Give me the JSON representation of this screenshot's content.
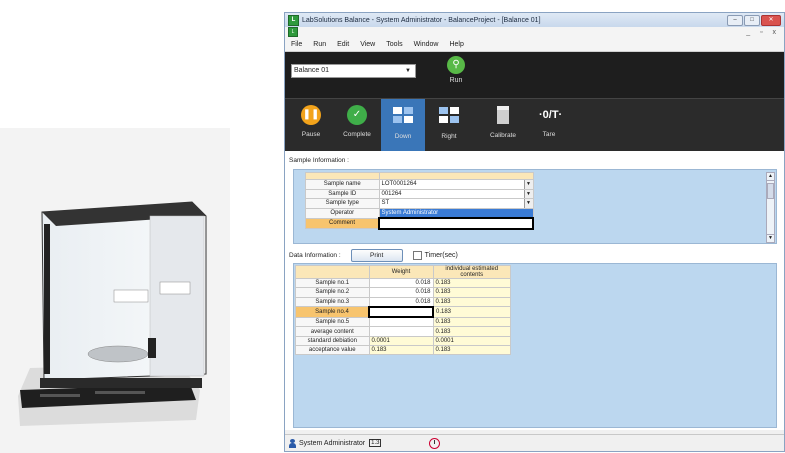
{
  "window": {
    "title": "LabSolutions Balance - System Administrator - BalanceProject - [Balance 01]",
    "buttons": [
      "–",
      "□",
      "✕"
    ],
    "mdi_buttons": "_ ▫ x"
  },
  "menu": [
    "File",
    "Run",
    "Edit",
    "View",
    "Tools",
    "Window",
    "Help"
  ],
  "run_panel": {
    "balance_selected": "Balance 01",
    "run_label": "Run"
  },
  "toolbar": {
    "buttons": [
      {
        "label": "Pause",
        "icon": "pause-icon"
      },
      {
        "label": "Complete",
        "icon": "check-icon"
      },
      {
        "label": "Down",
        "icon": "grid-down-icon",
        "active": true
      },
      {
        "label": "Right",
        "icon": "grid-right-icon"
      },
      {
        "label": "Calibrate",
        "icon": "weight-icon"
      },
      {
        "label": "Tare",
        "icon": "tare-icon",
        "glyph": "·0/T·"
      }
    ]
  },
  "sample_info": {
    "label": "Sample Information :",
    "rows": [
      {
        "label": "Sample name",
        "value": "LOT0001264"
      },
      {
        "label": "Sample ID",
        "value": "001264"
      },
      {
        "label": "Sample type",
        "value": "ST"
      },
      {
        "label": "Operator",
        "value": "System Administrator"
      },
      {
        "label": "Comment",
        "value": ""
      }
    ]
  },
  "data_info": {
    "label": "Data Information :",
    "print_label": "Print",
    "timer_label": "Timer(sec)",
    "headers": [
      "Weight",
      "individual estimated contents"
    ],
    "rows": [
      {
        "label": "Sample no.1",
        "weight": "0.018",
        "content": "0.183"
      },
      {
        "label": "Sample no.2",
        "weight": "0.018",
        "content": "0.183"
      },
      {
        "label": "Sample no.3",
        "weight": "0.018",
        "content": "0.183"
      },
      {
        "label": "Sample no.4",
        "weight": "",
        "content": "0.183"
      },
      {
        "label": "Sample no.5",
        "weight": "",
        "content": "0.183"
      },
      {
        "label": "average content",
        "weight": "",
        "content": "0.183"
      },
      {
        "label": "standard debiation",
        "weight": "0.0001",
        "content": "0.0001"
      },
      {
        "label": "acceptance value",
        "weight": "0.183",
        "content": "0.183"
      }
    ]
  },
  "status": {
    "user": "System Administrator",
    "badge": "1.3"
  },
  "colors": {
    "run_panel_bg": "#1e1e1e",
    "toolbar_active": "#3a76b8",
    "grid_bg": "#bcd7ef",
    "header_row": "#fbe7b8",
    "selected_row": "#f7c46e"
  }
}
